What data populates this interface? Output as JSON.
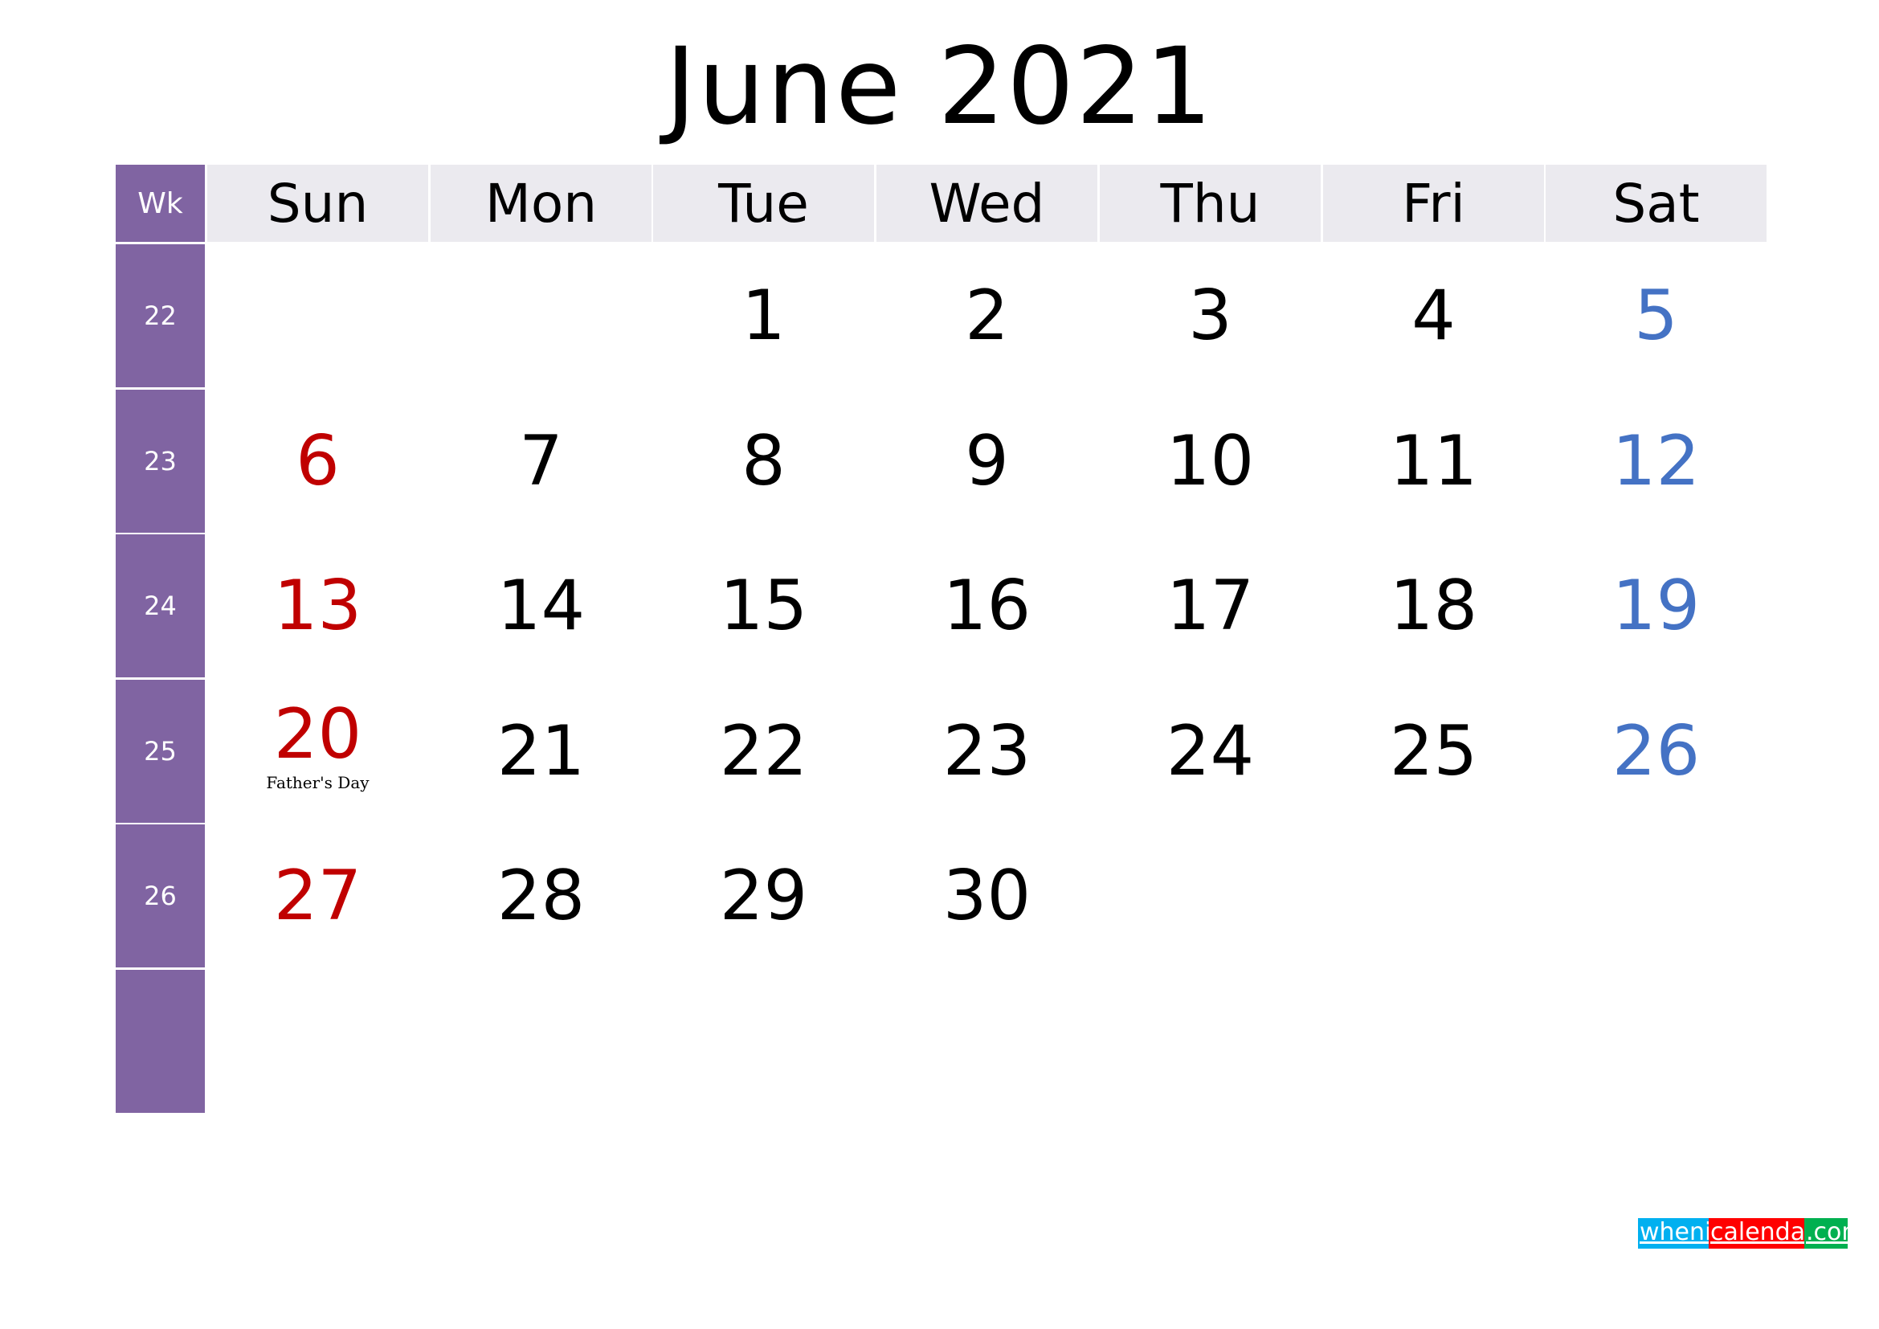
{
  "title": "June 2021",
  "header": {
    "week_label": "Wk",
    "days_of_week": [
      "Sun",
      "Mon",
      "Tue",
      "Wed",
      "Thu",
      "Fri",
      "Sat"
    ]
  },
  "colors": {
    "week_column": "#8064A2",
    "header_background": "#EBEAEF",
    "sunday": "#C00000",
    "saturday": "#4472C4",
    "weekday": "#000000"
  },
  "weeks": [
    {
      "week": "22",
      "days": [
        "",
        "",
        "1",
        "2",
        "3",
        "4",
        "5"
      ],
      "events": [
        "",
        "",
        "",
        "",
        "",
        "",
        ""
      ]
    },
    {
      "week": "23",
      "days": [
        "6",
        "7",
        "8",
        "9",
        "10",
        "11",
        "12"
      ],
      "events": [
        "",
        "",
        "",
        "",
        "",
        "",
        ""
      ]
    },
    {
      "week": "24",
      "days": [
        "13",
        "14",
        "15",
        "16",
        "17",
        "18",
        "19"
      ],
      "events": [
        "",
        "",
        "",
        "",
        "",
        "",
        ""
      ]
    },
    {
      "week": "25",
      "days": [
        "20",
        "21",
        "22",
        "23",
        "24",
        "25",
        "26"
      ],
      "events": [
        "Father's Day",
        "",
        "",
        "",
        "",
        "",
        ""
      ]
    },
    {
      "week": "26",
      "days": [
        "27",
        "28",
        "29",
        "30",
        "",
        "",
        ""
      ],
      "events": [
        "",
        "",
        "",
        "",
        "",
        "",
        ""
      ]
    },
    {
      "week": "",
      "days": [
        "",
        "",
        "",
        "",
        "",
        "",
        ""
      ],
      "events": [
        "",
        "",
        "",
        "",
        "",
        "",
        ""
      ]
    }
  ],
  "footer": {
    "logo_parts": [
      "whenis",
      "calendars",
      ".com"
    ],
    "logo_colors": [
      "#00B0F0",
      "#FF0000",
      "#00B050"
    ]
  }
}
